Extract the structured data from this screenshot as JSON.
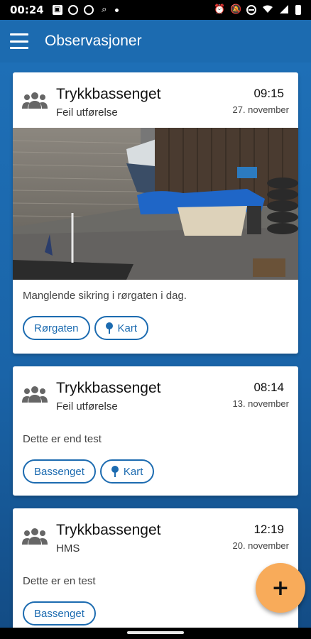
{
  "status_bar": {
    "time": "00:24",
    "icons_left": [
      "sim-card-icon",
      "app-icon",
      "messenger-icon",
      "search-icon",
      "dot-icon"
    ],
    "icons_right": [
      "alarm-icon",
      "notifications-off-icon",
      "do-not-disturb-icon",
      "wifi-icon",
      "signal-icon",
      "battery-icon"
    ]
  },
  "app_bar": {
    "title": "Observasjoner",
    "menu_icon": "hamburger-menu-icon"
  },
  "colors": {
    "primary": "#1c6bb0",
    "fab": "#f8ab5a",
    "card": "#ffffff"
  },
  "observations": [
    {
      "title": "Trykkbassenget",
      "category": "Feil utførelse",
      "time": "09:15",
      "date": "27. november",
      "has_photo": true,
      "description": "Manglende sikring i rørgaten i dag.",
      "chips": [
        {
          "label": "Rørgaten",
          "icon": null
        },
        {
          "label": "Kart",
          "icon": "map-pin-icon"
        }
      ]
    },
    {
      "title": "Trykkbassenget",
      "category": "Feil utførelse",
      "time": "08:14",
      "date": "13. november",
      "has_photo": false,
      "description": "Dette er end test",
      "chips": [
        {
          "label": "Bassenget",
          "icon": null
        },
        {
          "label": "Kart",
          "icon": "map-pin-icon"
        }
      ]
    },
    {
      "title": "Trykkbassenget",
      "category": "HMS",
      "time": "12:19",
      "date": "20. november",
      "has_photo": false,
      "description": "Dette er en test",
      "chips": [
        {
          "label": "Bassenget",
          "icon": null
        }
      ]
    }
  ],
  "fab": {
    "label": "+",
    "icon": "add-icon"
  }
}
